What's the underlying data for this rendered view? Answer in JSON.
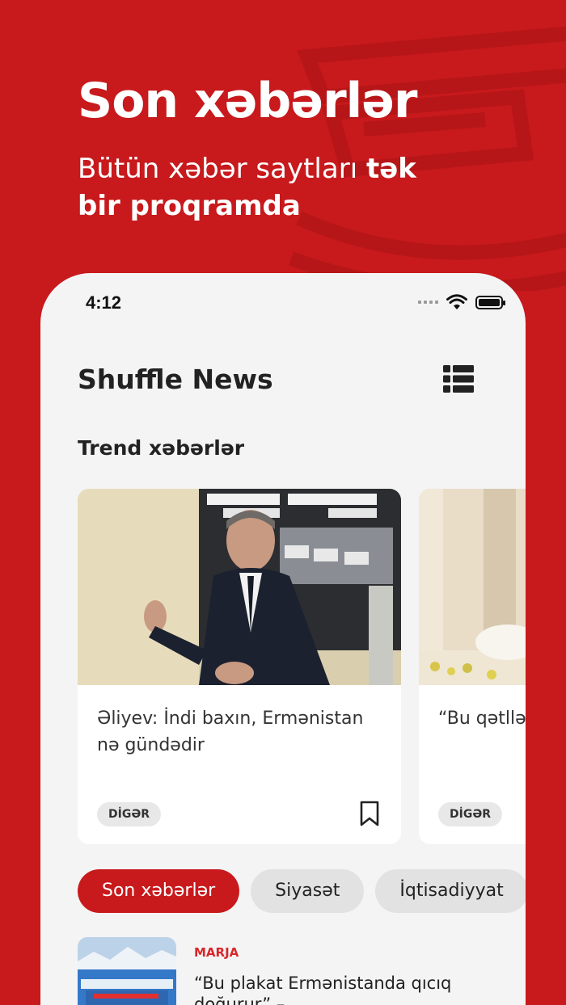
{
  "hero": {
    "title": "Son xəbərlər",
    "subtitle_regular": "Bütün xəbər saytları ",
    "subtitle_bold": "tək bir proqramda"
  },
  "status_bar": {
    "time": "4:12"
  },
  "app": {
    "title": "Shuffle News"
  },
  "trending": {
    "title": "Trend xəbərlər",
    "cards": [
      {
        "title": "Əliyev: İndi baxın, Ermənistan nə gündədir",
        "category": "DİGƏR"
      },
      {
        "title": "“Bu qətlləri qazandırmaq",
        "category": "DİGƏR"
      }
    ]
  },
  "tabs": [
    {
      "label": "Son xəbərlər",
      "active": true
    },
    {
      "label": "Siyasət",
      "active": false
    },
    {
      "label": "İqtisadiyyat",
      "active": false
    }
  ],
  "latest": [
    {
      "source": "MARJA",
      "title": "“Bu plakat Ermənistanda qıcıq doğurur” –"
    }
  ],
  "colors": {
    "brand": "#c8191c",
    "background": "#f4f4f4",
    "card": "#ffffff"
  }
}
